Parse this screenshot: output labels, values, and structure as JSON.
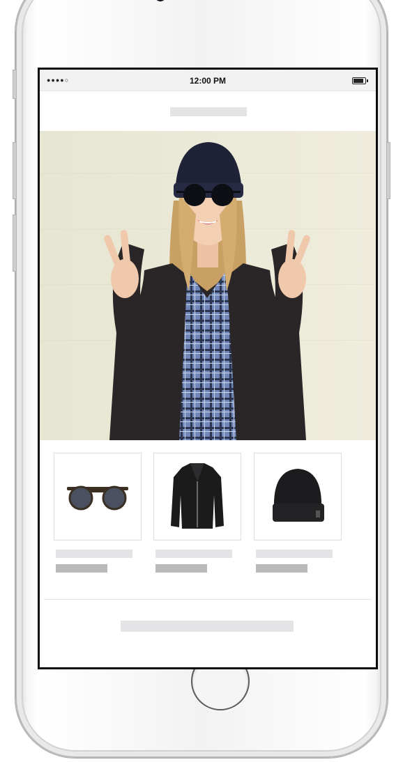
{
  "status_bar": {
    "signal": "●●●●○",
    "time": "12:00 PM",
    "battery_icon": "battery-full-icon"
  },
  "hero_image": {
    "description_icon": "model-photo-image"
  },
  "products": [
    {
      "icon": "sunglasses-icon"
    },
    {
      "icon": "leather-jacket-icon"
    },
    {
      "icon": "beanie-icon"
    }
  ],
  "colors": {
    "hero_background": "#ece9d6",
    "placeholder_light": "#e4e4e6",
    "placeholder_dark": "#b9b9bb",
    "screen_border": "#0b0b0b"
  }
}
